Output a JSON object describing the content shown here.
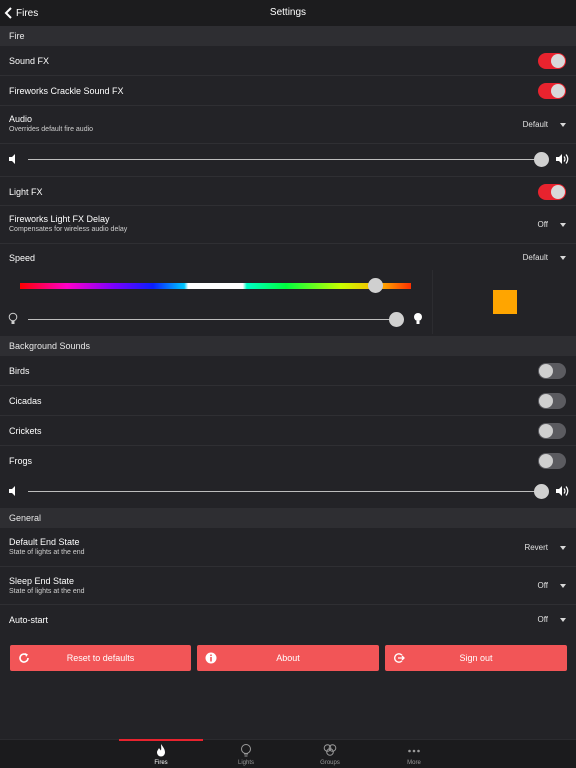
{
  "nav": {
    "back_label": "Fires",
    "title": "Settings"
  },
  "sections": {
    "fire": "Fire",
    "background": "Background Sounds",
    "general": "General"
  },
  "fire": {
    "sound_fx": {
      "label": "Sound FX",
      "on": true
    },
    "fireworks_crackle": {
      "label": "Fireworks Crackle Sound FX",
      "on": true
    },
    "audio": {
      "label": "Audio",
      "sub": "Overrides default fire audio",
      "value": "Default"
    },
    "volume": 1.0,
    "light_fx": {
      "label": "Light FX",
      "on": true
    },
    "fireworks_delay": {
      "label": "Fireworks Light FX Delay",
      "sub": "Compensates for wireless audio delay",
      "value": "Off"
    },
    "speed": {
      "label": "Speed",
      "value": "Default"
    },
    "hue_position": 0.91,
    "brightness": 0.98,
    "swatch_color": "#ffa500"
  },
  "background": {
    "birds": {
      "label": "Birds",
      "on": false
    },
    "cicadas": {
      "label": "Cicadas",
      "on": false
    },
    "crickets": {
      "label": "Crickets",
      "on": false
    },
    "frogs": {
      "label": "Frogs",
      "on": false
    },
    "volume": 1.0
  },
  "general": {
    "default_end": {
      "label": "Default End State",
      "sub": "State of lights at the end",
      "value": "Revert"
    },
    "sleep_end": {
      "label": "Sleep End State",
      "sub": "State of lights at the end",
      "value": "Off"
    },
    "auto_start": {
      "label": "Auto-start",
      "value": "Off"
    }
  },
  "buttons": {
    "reset": "Reset to defaults",
    "about": "About",
    "signout": "Sign out"
  },
  "tabs": [
    {
      "label": "Fires",
      "icon": "flame-icon",
      "active": true
    },
    {
      "label": "Lights",
      "icon": "bulb-icon",
      "active": false
    },
    {
      "label": "Groups",
      "icon": "group-bulbs-icon",
      "active": false
    },
    {
      "label": "More",
      "icon": "more-dots-icon",
      "active": false
    }
  ],
  "colors": {
    "accent": "#e8232e",
    "button": "#f25557",
    "background": "#232327",
    "section": "#2e2e32"
  }
}
